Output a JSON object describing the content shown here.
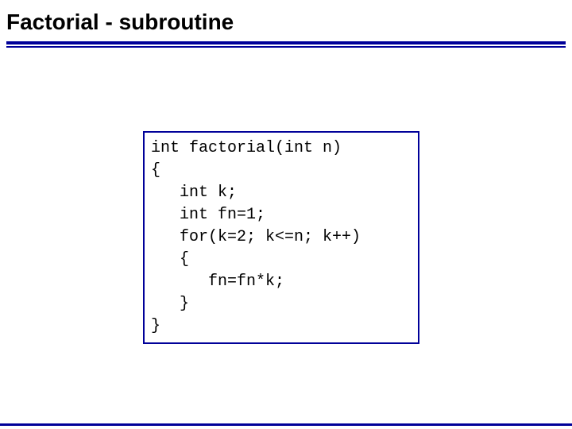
{
  "title": "Factorial - subroutine",
  "code": {
    "l1": "int factorial(int n)",
    "l2": "{",
    "l3": "   int k;",
    "l4": "   int fn=1;",
    "l5": "   for(k=2; k<=n; k++)",
    "l6": "   {",
    "l7": "      fn=fn*k;",
    "l8": "   }",
    "l9": "}"
  }
}
